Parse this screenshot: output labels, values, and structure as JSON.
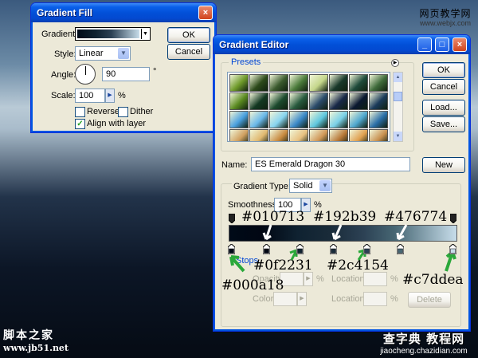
{
  "watermark_top": {
    "cn": "网页教学网",
    "url": "www.webjx.com"
  },
  "watermark_left": {
    "cn": "脚本之家",
    "url": "www.jb51.net"
  },
  "watermark_bottom": {
    "cn": "查字典 教程网",
    "url": "jiaocheng.chazidian.com"
  },
  "gradient_fill": {
    "title": "Gradient Fill",
    "close_glyph": "×",
    "gradient_label": "Gradient:",
    "style_label": "Style:",
    "style_value": "Linear",
    "angle_label": "Angle:",
    "angle_value": "90",
    "degree_symbol": "°",
    "scale_label": "Scale:",
    "scale_value": "100",
    "percent": "%",
    "reverse_label": "Reverse",
    "dither_label": "Dither",
    "align_label": "Align with layer",
    "ok_label": "OK",
    "cancel_label": "Cancel",
    "checkmark": "✓",
    "gradient_colors": [
      "#000a18",
      "#0f2231",
      "#2c4154",
      "#c7ddea"
    ]
  },
  "gradient_editor": {
    "title": "Gradient Editor",
    "title_buttons": {
      "minimize": "_",
      "maximize": "□",
      "close": "×"
    },
    "presets_label": "Presets",
    "ok_label": "OK",
    "cancel_label": "Cancel",
    "load_label": "Load...",
    "save_label": "Save...",
    "name_label": "Name:",
    "name_value": "ES Emerald Dragon 30",
    "new_label": "New",
    "gradient_type_label": "Gradient Type:",
    "gradient_type_value": "Solid",
    "smoothness_label": "Smoothness:",
    "smoothness_value": "100",
    "percent": "%",
    "stops_label": "Stops",
    "opacity_label": "Opacity:",
    "location_label": "Location:",
    "color_label": "Color:",
    "delete_label": "Delete",
    "presets": [
      [
        "#6e9a2a",
        "#2c4a1a",
        "#3b5a2e",
        "#4a7a3a",
        "#c4d68a",
        "#18382a",
        "#1e4a3a",
        "#3e6a3a"
      ],
      [
        "#5a8a20",
        "#123822",
        "#1c4a2e",
        "#285a3e",
        "#2a4a6a",
        "#182848",
        "#0a1830",
        "#1a3a5a"
      ],
      [
        "#4aa0e0",
        "#6ab8ea",
        "#88d4f0",
        "#3a88c8",
        "#60c8e0",
        "#7ad0e8",
        "#50a8d0",
        "#2a6ea8"
      ],
      [
        "#d0a060",
        "#e0b870",
        "#c88a40",
        "#e8c080",
        "#d09858",
        "#b87838",
        "#e0a050",
        "#c89050"
      ]
    ],
    "gradient_colors": [
      "#000a18",
      "#010713",
      "#0f2231",
      "#192b39",
      "#2c4154",
      "#476774",
      "#c7ddea"
    ]
  },
  "annotations": {
    "c1": "#010713",
    "c2": "#192b39",
    "c3": "#476774",
    "c4": "#0f2231",
    "c5": "#2c4154",
    "c6": "#000a18",
    "c7": "#c7ddea"
  },
  "colors": {
    "arrow_green": "#2aa83a"
  }
}
